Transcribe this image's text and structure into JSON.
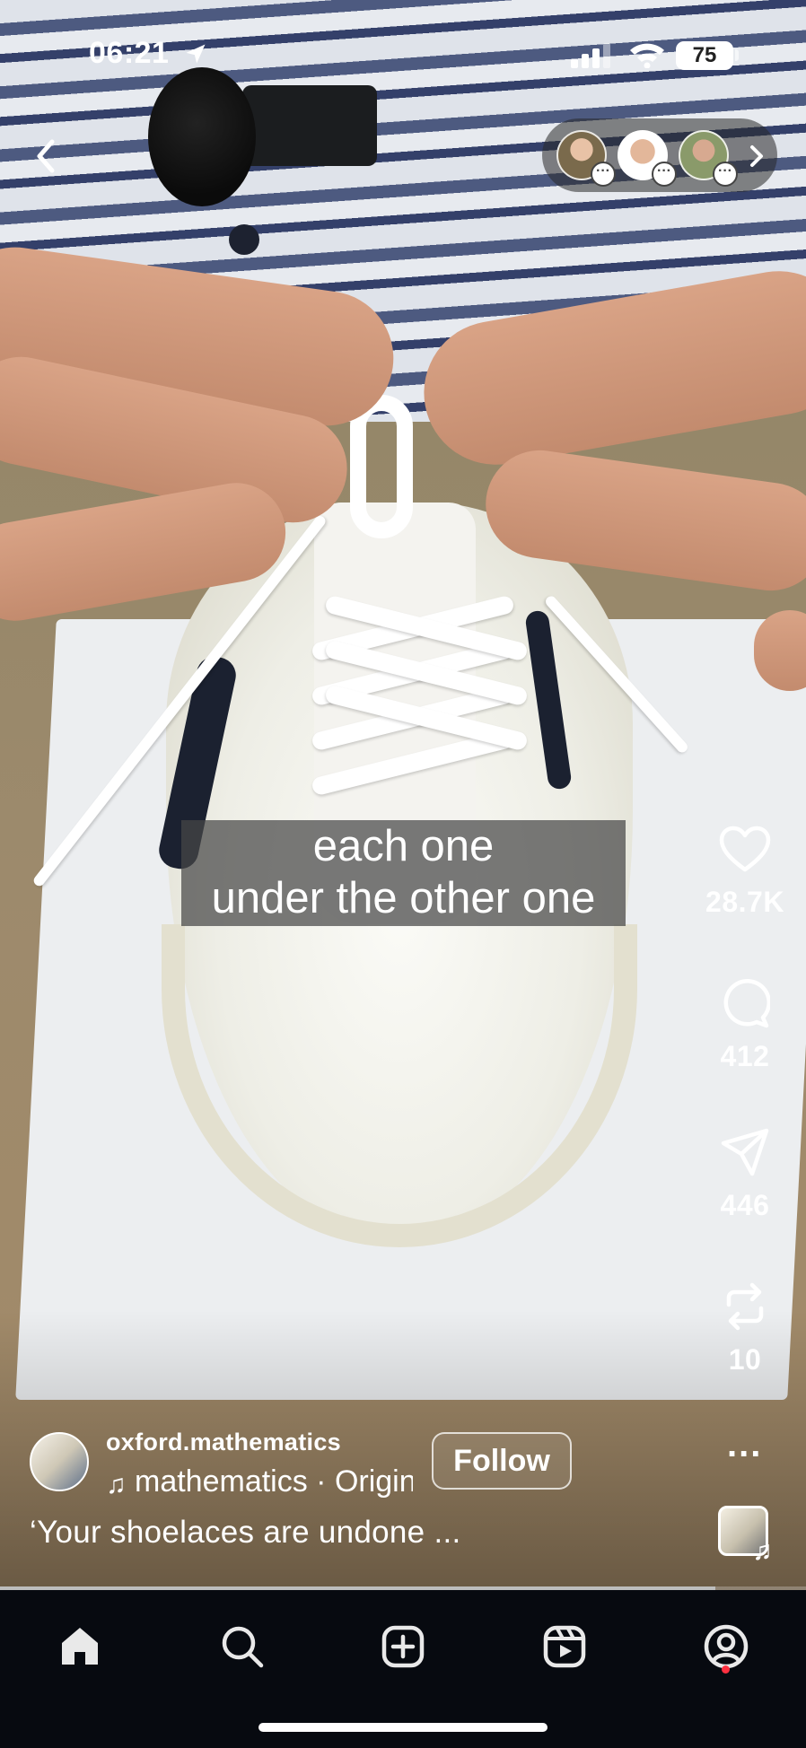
{
  "status_bar": {
    "time": "06:21",
    "battery": "75"
  },
  "video": {
    "caption_lines": [
      "each one",
      "under the other one"
    ],
    "progress_fraction": 0.887
  },
  "top_bar": {
    "back_icon": "chevron-left-icon",
    "viewer_avatars": [
      "avatar-woman",
      "avatar-man",
      "avatar-person"
    ],
    "viewers_chevron_icon": "chevron-right-icon"
  },
  "actions": {
    "likes": "28.7K",
    "comments": "412",
    "shares": "446",
    "reposts": "10",
    "more_label": "..."
  },
  "post": {
    "username": "oxford.mathematics",
    "follow_label": "Follow",
    "audio_text": "mathematics · Original audio",
    "description": "‘Your shoelaces are undone ..."
  },
  "tabs": [
    "home-icon",
    "search-icon",
    "create-icon",
    "reels-icon",
    "profile-icon"
  ],
  "colors": {
    "tabbar_background": "#070a10",
    "notification_dot": "#ff3040",
    "caption_background": "rgba(70,70,70,0.72)"
  }
}
